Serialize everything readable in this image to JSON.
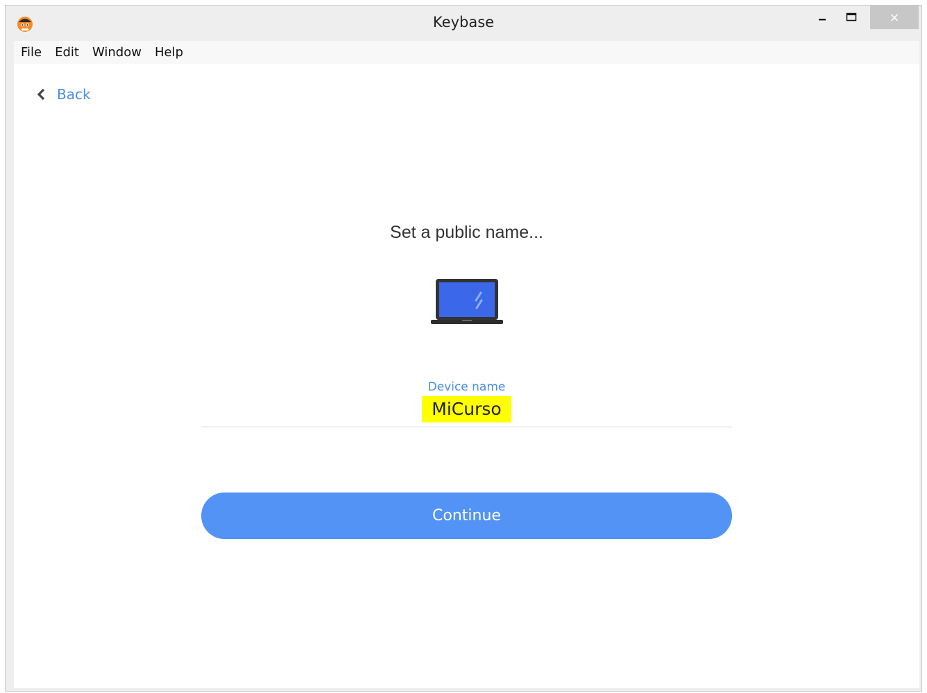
{
  "window": {
    "title": "Keybase",
    "close_glyph": "×"
  },
  "menubar": {
    "items": [
      "File",
      "Edit",
      "Window",
      "Help"
    ]
  },
  "nav": {
    "back_label": "Back"
  },
  "main": {
    "heading": "Set a public name...",
    "device_icon": "laptop-icon",
    "field_label": "Device name",
    "field_value": "MiCurso",
    "continue_label": "Continue"
  },
  "colors": {
    "accent": "#5293f5",
    "link": "#4a8fe7",
    "highlight": "#ffff00"
  }
}
